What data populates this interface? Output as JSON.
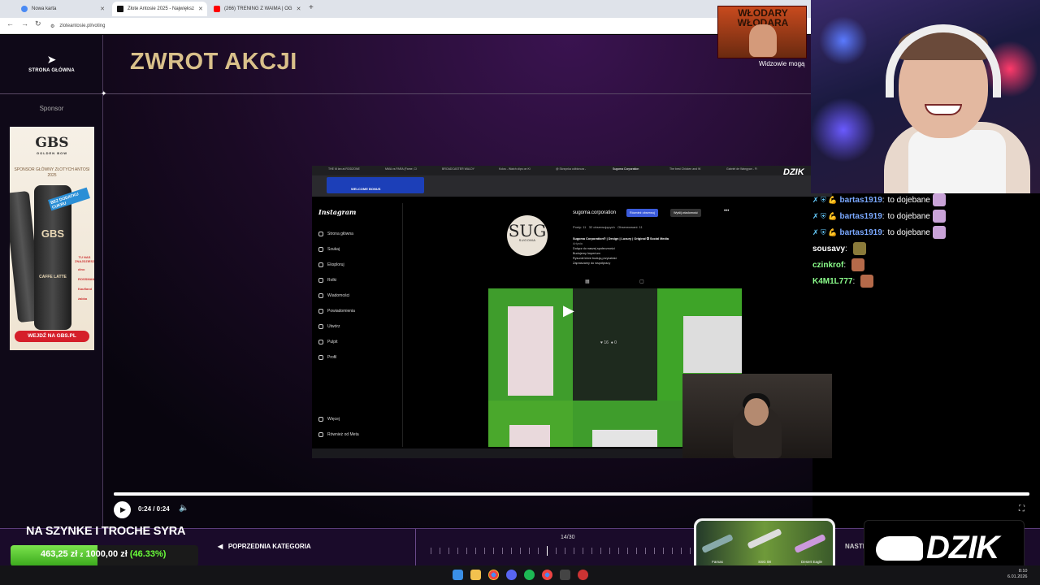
{
  "browser": {
    "tabs": [
      {
        "label": "Nowa karta",
        "active": false,
        "icon_color": "#4a8af4"
      },
      {
        "label": "Złote Antosie 2025 - Największ",
        "active": true,
        "icon_color": "#111111"
      },
      {
        "label": "(266) TRENING Z WAIMA | OG",
        "active": false,
        "icon_color": "#ff0000"
      }
    ],
    "url": "zloteantosie.pl/voting"
  },
  "page": {
    "back_label": "STRONA GŁÓWNA",
    "title": "ZWROT AKCJI",
    "sponsor_label": "Sponsor",
    "ad": {
      "logo": "GBS",
      "logo_sub": "GOLDEN BOW",
      "sponsor_line": "SPONSOR GŁÓWNY ZŁOTYCH ANTOSI 2025",
      "stripe": "BEZ DODATKU CUKRU",
      "can_brand": "GBS",
      "flavor": "CAFFE LATTE",
      "available": "TU NAS ZNAJDZIESZ",
      "retailers": [
        "dino",
        "ROSSMANN",
        "Kaufland",
        "żabka"
      ],
      "cta": "WEJDŹ NA GBS.PL"
    }
  },
  "video": {
    "inner_tabs": [
      "THE M łan at RODZONE",
      "MMA vs PARA (Fame, Cl",
      "BROADCASTER WALDY",
      "Kolos - Watch clips on Ki",
      "@ Skrzynka odbiorcza -",
      "Sugoma Corporation",
      "The best Chicken and W",
      "Gabriel de Wangyan - Fi"
    ],
    "bonus_label": "WELCOME BONUS",
    "corner_logo": "DZIK",
    "instagram": {
      "logo": "Instagram",
      "menu": [
        "Strona główna",
        "Szukaj",
        "Eksploruj",
        "Rolki",
        "Wiadomości",
        "Powiadomienia",
        "Utwórz",
        "Pulpit",
        "Profil"
      ],
      "more": "Więcej",
      "also": "Również od Meta",
      "avatar_mono": "SUG",
      "avatar_name": "SUGOMA",
      "username": "sugoma.corporation",
      "follow_btn": "Również obserwuj",
      "message_btn": "Wyślij wiadomość",
      "stats": [
        "Posty: 11",
        "32 obserwujących",
        "Obserwowani: 11"
      ],
      "bio": [
        "Sugoma Corporation® | Design | Luxury | Original ✪ Social Media",
        "Artysta",
        "Dołącz do naszej społeczności",
        "Budujemy Imperium",
        "Rysunki które budują przyszłość",
        "Zapraszamy do współpracy"
      ],
      "likes": "16",
      "comments": "0"
    }
  },
  "player": {
    "time": "0:24 / 0:24",
    "progress": 1.0
  },
  "bottom": {
    "prev_category": "POPRZEDNIA KATEGORIA",
    "counter": "14/30",
    "next_category": "NASTĘ"
  },
  "donation": {
    "title": "NA SZYNKE I TROCHE SYRA",
    "current": "463,25 zł",
    "sep": "z",
    "goal": "1000,00 zł",
    "percent_label": "(46.33%)",
    "fraction": 0.4633
  },
  "overlay": {
    "banner_text": "WŁODARY WŁODARA",
    "viewers_note": "Widzowie mogą",
    "weapon_card": [
      "Famas",
      "SSG 08",
      "Desert Eagle"
    ],
    "weapon_card_sub": [
      "Sergeant",
      "Dream Believer",
      "Nuclear Dragon"
    ],
    "logo": "DZIK"
  },
  "chat": [
    {
      "user": "bartas1919",
      "message": "to dojebane",
      "color": "#7aa8ff",
      "badges": "✗ ⛨ 💪"
    },
    {
      "user": "bartas1919",
      "message": "to dojebane",
      "color": "#7aa8ff",
      "badges": "✗ ⛨ 💪"
    },
    {
      "user": "bartas1919",
      "message": "to dojebane",
      "color": "#7aa8ff",
      "badges": "✗ ⛨ 💪"
    },
    {
      "user": "sousavy",
      "message": "",
      "color": "#ffffff",
      "badges": ""
    },
    {
      "user": "czinkrof",
      "message": "",
      "color": "#8cff8c",
      "badges": ""
    },
    {
      "user": "K4M1L777",
      "message": "",
      "color": "#8cff8c",
      "badges": ""
    }
  ],
  "clock": {
    "time": "8:10",
    "date": "6.01.2026"
  }
}
